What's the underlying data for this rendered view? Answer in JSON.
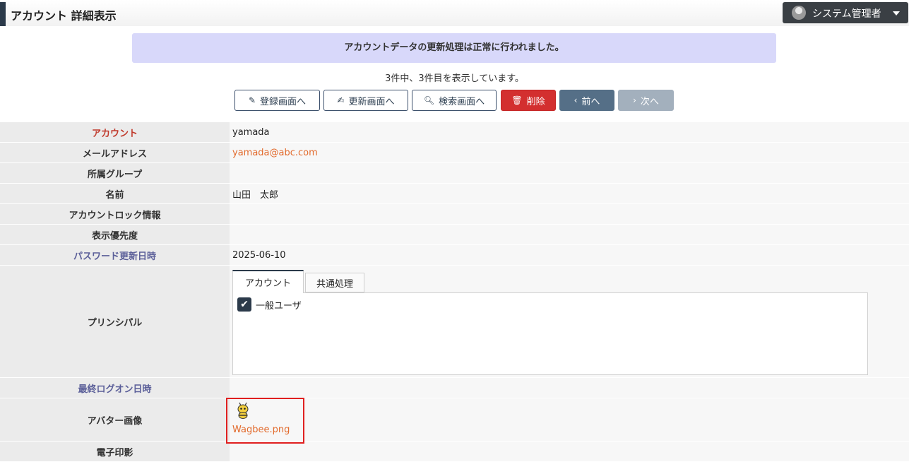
{
  "header": {
    "title": "アカウント 詳細表示",
    "user_menu": {
      "name": "システム管理者",
      "icon": "user-circle-icon"
    }
  },
  "notice": "アカウントデータの更新処理は正常に行われました。",
  "paging_info": "3件中、3件目を表示しています。",
  "buttons": {
    "register": "登録画面へ",
    "update": "更新画面へ",
    "search": "検索画面へ",
    "delete": "削除",
    "prev": "前へ",
    "next": "次へ"
  },
  "colors": {
    "accent": "#2b3a4a",
    "danger": "#d32f2f",
    "link": "#e26a2c",
    "notice_bg": "#d8d8fa"
  },
  "fields": {
    "account": {
      "label": "アカウント",
      "value": "yamada"
    },
    "email": {
      "label": "メールアドレス",
      "value": "yamada@abc.com"
    },
    "group": {
      "label": "所属グループ",
      "value": ""
    },
    "name": {
      "label": "名前",
      "value": "山田　太郎"
    },
    "lock": {
      "label": "アカウントロック情報",
      "value": ""
    },
    "priority": {
      "label": "表示優先度",
      "value": ""
    },
    "pw_updated": {
      "label": "パスワード更新日時",
      "value": "2025-06-10"
    },
    "principal": {
      "label": "プリンシパル",
      "tabs": [
        "アカウント",
        "共通処理"
      ],
      "items": [
        {
          "label": "一般ユーザ",
          "checked": true
        }
      ]
    },
    "last_logon": {
      "label": "最終ログオン日時",
      "value": ""
    },
    "avatar": {
      "label": "アバター画像",
      "file": "Wagbee.png"
    },
    "seal": {
      "label": "電子印影",
      "value": ""
    }
  }
}
